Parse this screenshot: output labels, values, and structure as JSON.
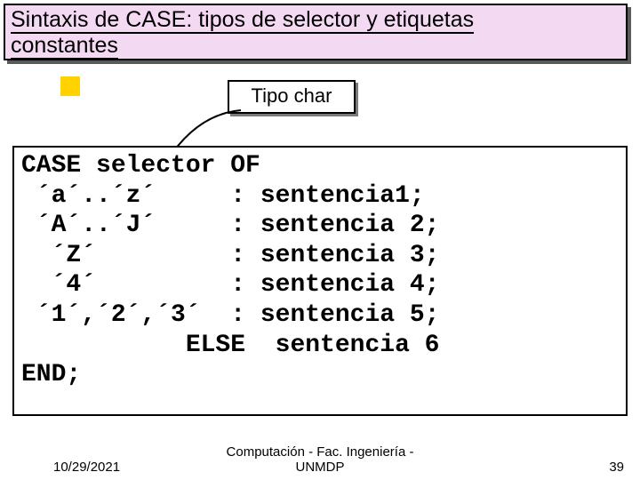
{
  "title": {
    "line1": "Sintaxis de CASE: tipos de selector y etiquetas",
    "line2": "constantes"
  },
  "label": "Tipo char",
  "code": {
    "l1": "CASE selector OF",
    "l2": " ´a´..´z´     : sentencia1;",
    "l3": " ´A´..´J´     : sentencia 2;",
    "l4": "  ´Z´         : sentencia 3;",
    "l5": "  ´4´         : sentencia 4;",
    "l6": " ´1´,´2´,´3´  : sentencia 5;",
    "l7": "           ELSE  sentencia 6",
    "l8": "END;"
  },
  "footer": {
    "date": "10/29/2021",
    "center1": "Computación - Fac. Ingeniería -",
    "center2": "UNMDP",
    "page": "39"
  }
}
